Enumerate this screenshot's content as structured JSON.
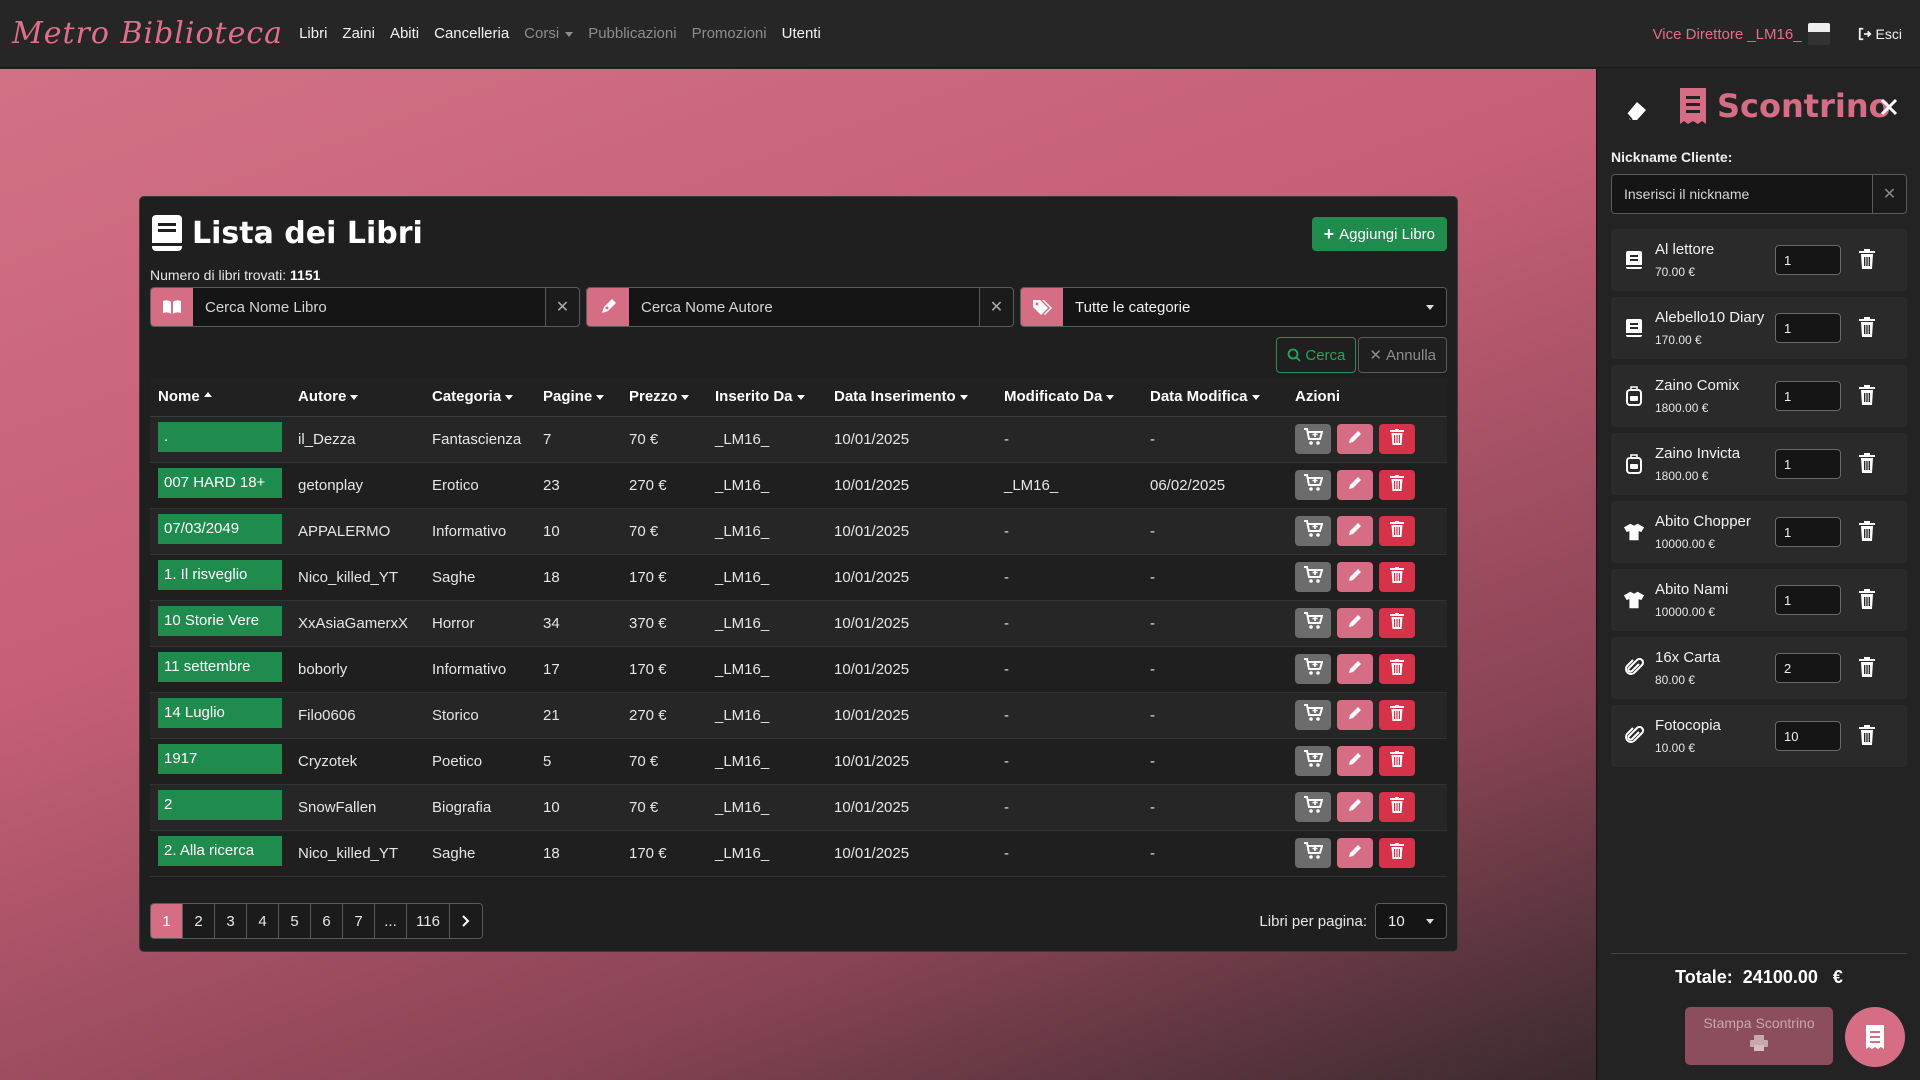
{
  "navbar": {
    "brand": "Metro Biblioteca",
    "links": [
      {
        "label": "Libri",
        "muted": false
      },
      {
        "label": "Zaini",
        "muted": false
      },
      {
        "label": "Abiti",
        "muted": false
      },
      {
        "label": "Cancelleria",
        "muted": false
      },
      {
        "label": "Corsi",
        "muted": true,
        "dropdown": true
      },
      {
        "label": "Pubblicazioni",
        "muted": true
      },
      {
        "label": "Promozioni",
        "muted": true
      },
      {
        "label": "Utenti",
        "muted": false
      }
    ],
    "user": "Vice Direttore _LM16_",
    "logout": "Esci"
  },
  "card": {
    "title": "Lista dei Libri",
    "add_button": "Aggiungi Libro",
    "count_label": "Numero di libri trovati:",
    "count_value": "1151",
    "search_book_placeholder": "Cerca Nome Libro",
    "search_author_placeholder": "Cerca Nome Autore",
    "category_selected": "Tutte le categorie",
    "search_button": "Cerca",
    "cancel_button": "Annulla",
    "columns": [
      "Nome",
      "Autore",
      "Categoria",
      "Pagine",
      "Prezzo",
      "Inserito Da",
      "Data Inserimento",
      "Modificato Da",
      "Data Modifica",
      "Azioni"
    ],
    "rows": [
      {
        "nome": ".",
        "autore": "il_Dezza",
        "categoria": "Fantascienza",
        "pagine": "7",
        "prezzo": "70 €",
        "inserito_da": "_LM16_",
        "data_ins": "10/01/2025",
        "modificato_da": "-",
        "data_mod": "-"
      },
      {
        "nome": "007 HARD 18+",
        "autore": "getonplay",
        "categoria": "Erotico",
        "pagine": "23",
        "prezzo": "270 €",
        "inserito_da": "_LM16_",
        "data_ins": "10/01/2025",
        "modificato_da": "_LM16_",
        "data_mod": "06/02/2025"
      },
      {
        "nome": "07/03/2049",
        "autore": "APPALERMO",
        "categoria": "Informativo",
        "pagine": "10",
        "prezzo": "70 €",
        "inserito_da": "_LM16_",
        "data_ins": "10/01/2025",
        "modificato_da": "-",
        "data_mod": "-"
      },
      {
        "nome": "1. Il risveglio",
        "autore": "Nico_killed_YT",
        "categoria": "Saghe",
        "pagine": "18",
        "prezzo": "170 €",
        "inserito_da": "_LM16_",
        "data_ins": "10/01/2025",
        "modificato_da": "-",
        "data_mod": "-"
      },
      {
        "nome": "10 Storie Vere",
        "autore": "XxAsiaGamerxX",
        "categoria": "Horror",
        "pagine": "34",
        "prezzo": "370 €",
        "inserito_da": "_LM16_",
        "data_ins": "10/01/2025",
        "modificato_da": "-",
        "data_mod": "-"
      },
      {
        "nome": "11 settembre",
        "autore": "boborly",
        "categoria": "Informativo",
        "pagine": "17",
        "prezzo": "170 €",
        "inserito_da": "_LM16_",
        "data_ins": "10/01/2025",
        "modificato_da": "-",
        "data_mod": "-"
      },
      {
        "nome": "14 Luglio",
        "autore": "Filo0606",
        "categoria": "Storico",
        "pagine": "21",
        "prezzo": "270 €",
        "inserito_da": "_LM16_",
        "data_ins": "10/01/2025",
        "modificato_da": "-",
        "data_mod": "-"
      },
      {
        "nome": "1917",
        "autore": "Cryzotek",
        "categoria": "Poetico",
        "pagine": "5",
        "prezzo": "70 €",
        "inserito_da": "_LM16_",
        "data_ins": "10/01/2025",
        "modificato_da": "-",
        "data_mod": "-"
      },
      {
        "nome": "2",
        "autore": "SnowFallen",
        "categoria": "Biografia",
        "pagine": "10",
        "prezzo": "70 €",
        "inserito_da": "_LM16_",
        "data_ins": "10/01/2025",
        "modificato_da": "-",
        "data_mod": "-"
      },
      {
        "nome": "2. Alla ricerca",
        "autore": "Nico_killed_YT",
        "categoria": "Saghe",
        "pagine": "18",
        "prezzo": "170 €",
        "inserito_da": "_LM16_",
        "data_ins": "10/01/2025",
        "modificato_da": "-",
        "data_mod": "-"
      }
    ],
    "pages": [
      "1",
      "2",
      "3",
      "4",
      "5",
      "6",
      "7",
      "...",
      "116"
    ],
    "active_page": "1",
    "per_page_label": "Libri per pagina:",
    "per_page_value": "10"
  },
  "sidebar": {
    "title": "Scontrino",
    "nickname_label": "Nickname Cliente:",
    "nickname_placeholder": "Inserisci il nickname",
    "items": [
      {
        "name": "Al lettore",
        "price": "70.00 €",
        "qty": "1",
        "icon": "book-icon"
      },
      {
        "name": "Alebello10 Diary",
        "price": "170.00 €",
        "qty": "1",
        "icon": "book-icon"
      },
      {
        "name": "Zaino Comix",
        "price": "1800.00 €",
        "qty": "1",
        "icon": "backpack-icon"
      },
      {
        "name": "Zaino Invicta",
        "price": "1800.00 €",
        "qty": "1",
        "icon": "backpack-icon"
      },
      {
        "name": "Abito Chopper",
        "price": "10000.00 €",
        "qty": "1",
        "icon": "shirt-icon"
      },
      {
        "name": "Abito Nami",
        "price": "10000.00 €",
        "qty": "1",
        "icon": "shirt-icon"
      },
      {
        "name": "16x Carta",
        "price": "80.00 €",
        "qty": "2",
        "icon": "paperclip-icon"
      },
      {
        "name": "Fotocopia",
        "price": "10.00 €",
        "qty": "10",
        "icon": "paperclip-icon"
      }
    ],
    "total_label": "Totale:",
    "total_value": "24100.00",
    "total_currency": "€",
    "print_button": "Stampa Scontrino"
  },
  "colors": {
    "accent": "#d56d85",
    "success": "#1f8c4e",
    "danger": "#d6334a",
    "dark": "#1f1f1f"
  }
}
